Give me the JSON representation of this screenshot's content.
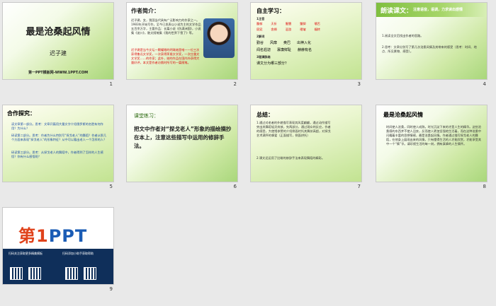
{
  "slides": [
    {
      "num": "1",
      "title": "最是沧桑起风情",
      "author": "迟子建",
      "footer": "第一PPT模板网-WWW.1PPT.COM"
    },
    {
      "num": "2",
      "heading": "作者简介：",
      "bio1": "迟子建，女，我国当代具有广泛影响力的作家之一。1983年开始写作，至今已发表以小说为主的文学作品五百余万字，主要作品：长篇小说《伪满洲国》，小说集《逝川》，散文随笔集《我的世界下雪了》等。",
      "bio2": "迟子建是当今文坛一颗耀眼的明珠她是唯一一位三次获得鲁迅文学奖，一次获得茅盾文学奖，一次庄重文文学奖……的作家；此外，她的作品在国内外获得大量好评，本文是作者访俄时所写的一篇随笔。"
    },
    {
      "num": "3",
      "heading": "自主学习：",
      "s1": "1注音",
      "row1": [
        "馥郁",
        "夭折",
        "腥膻",
        "蹩脚",
        "嚼舌"
      ],
      "row2": [
        "窈窕",
        "衾褥",
        "洄游",
        "褶皱",
        "辗转"
      ],
      "s2": "2解词",
      "words1": [
        "勤谷",
        "风靡",
        "奥巴",
        "出神入化"
      ],
      "words2": [
        "闻名遐迩",
        "寡廉鲜耻",
        "赫赫有名"
      ],
      "s3": "3理清脉络",
      "q": "课文分为哪三部分？"
    },
    {
      "num": "4",
      "heading": "朗读课文：",
      "heading_note": "注意语音，语调，力求读出感情",
      "q1": "1.阅读全文后找出作者的思路。",
      "q2": "2.思考：文章分别写了第几次沧桑风情及其带来的感受（思考：时间、地点、所见景物、感受）。"
    },
    {
      "num": "5",
      "heading": "合作探究：",
      "b1": "读文章第一部分。思考：文章开篇用大量文字介绍俄罗斯的名胜有何作用？为什么？",
      "b2": "研读第二部分。思考：作者为什么特别写“探戈老人”的舞蹈？作者从那几个方面来表现“探戈老人”的形象特征？从中可以看出老人一个怎样的人？",
      "b3": "研读第三部分。思考：从探戈老人的舞蹈中，作者得到了怎样的人生感悟？你有什么感悟呢？"
    },
    {
      "num": "6",
      "heading": "课堂练习：",
      "text": "把文中作者对“探戈老人”形象的描绘摘抄在本上，注意这些描写中运用的修辞手法。"
    },
    {
      "num": "7",
      "heading": "总结：",
      "p1": "1.通过对老者的外貌描写表现其风度翩翩，通过动作描写突出其舞蹈轻灵奔放，先两部分，通过观众的反应，作者的感受，大使馆参赞的介绍侧面衬托其舞技高超，对探戈艺术满怀的挚爱（正面描写，侧面烘托）",
      "p2": "2.课文还运用了比喻的修辞手法来表现舞蹈的精彩。"
    },
    {
      "num": "8",
      "heading": "最是沧桑起风情",
      "text": "时间使人沧桑，同时使人成熟。时光沉淀下来的才是人生的精华。这些沧桑感的东西并不使人沮丧，反而使人更加坚强地生活着，而在这种沧桑中闪耀着丰富的思想情感，最是沧桑起风情。作者通过描写探戈老人的舞蹈，在他身上展现出来的风情，只有懂得生活的人才能欣赏，才能享受其中一个“情”字。请珍视生活的每一刻，拥有真挚的人生情怀。"
    },
    {
      "num": "9",
      "logo_a": "第",
      "logo_b": "1",
      "logo_c": "PPT",
      "qr1": "扫码关注获取更多精美模板",
      "qr2": "扫码添加小助手获取帮助"
    }
  ]
}
